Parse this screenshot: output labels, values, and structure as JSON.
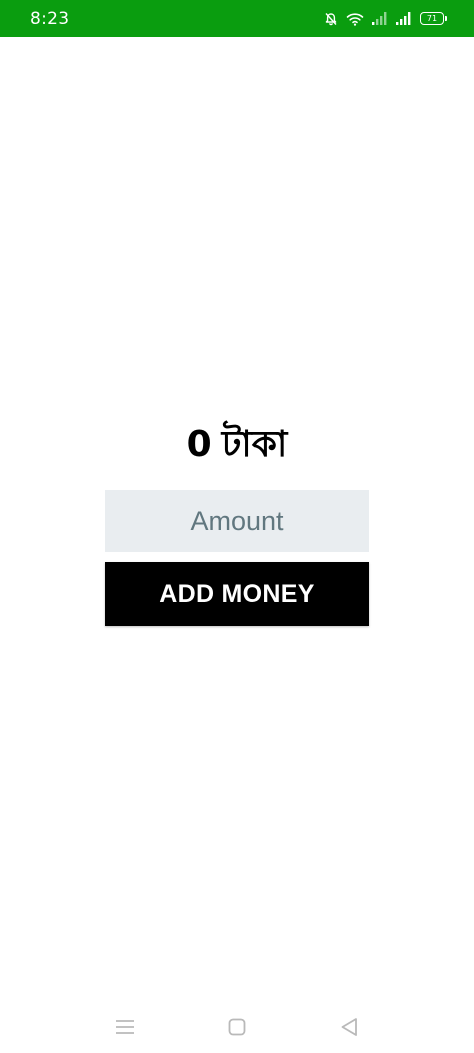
{
  "status_bar": {
    "time": "8:23",
    "battery_level": "71",
    "background_color": "#0a9d0f",
    "icons": [
      "bell-off-icon",
      "wifi-icon",
      "signal-1-icon",
      "signal-2-icon",
      "battery-icon"
    ]
  },
  "balance": {
    "amount": "0",
    "currency": "টাকা"
  },
  "amount_input": {
    "value": "",
    "placeholder": "Amount"
  },
  "add_money_button": {
    "label": "ADD MONEY"
  },
  "nav_bar": {
    "icons": [
      "menu-icon",
      "home-square-icon",
      "back-triangle-icon"
    ]
  }
}
